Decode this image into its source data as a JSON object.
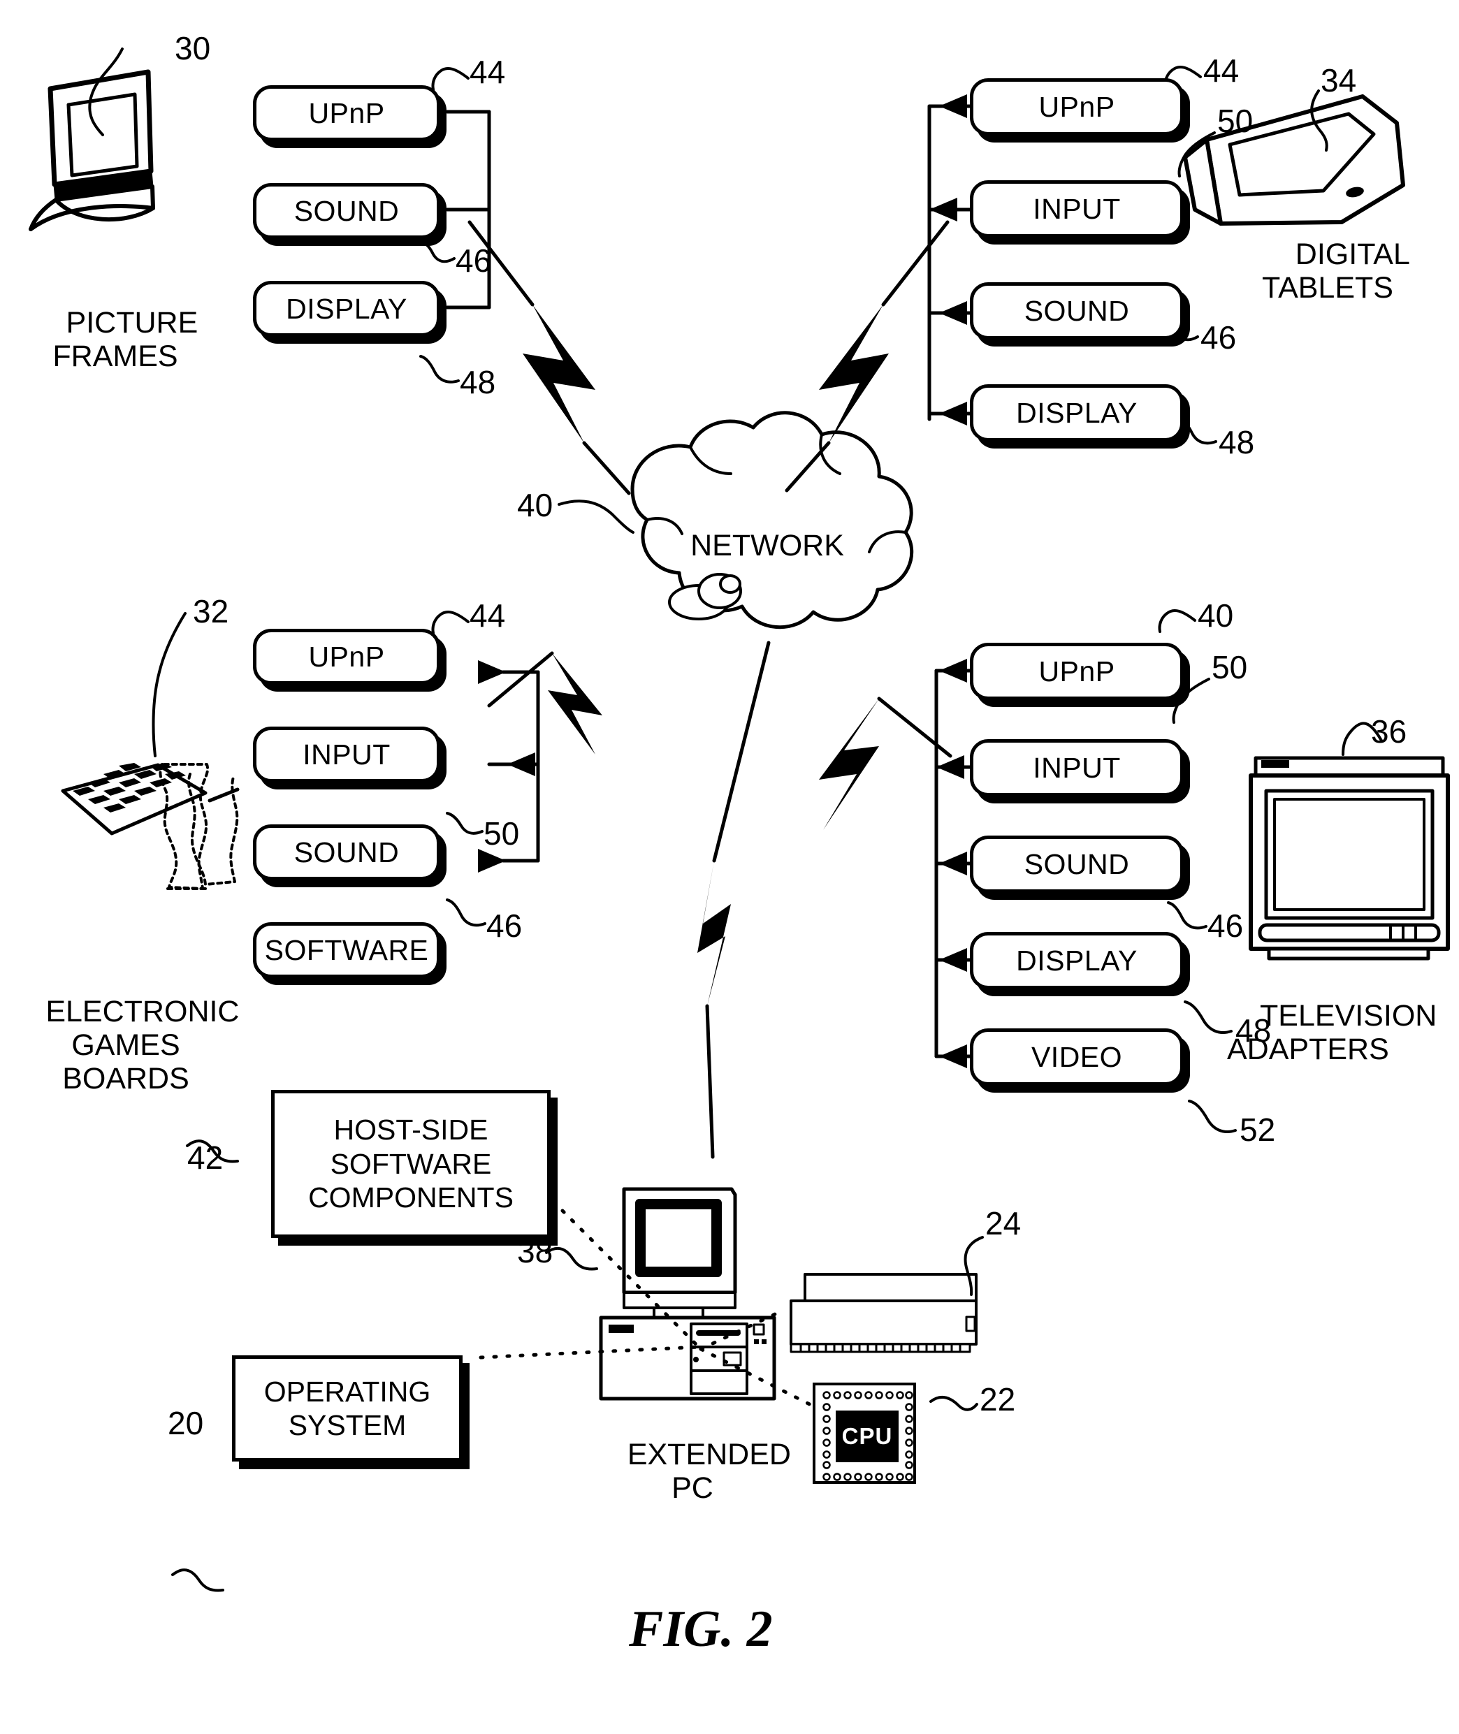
{
  "figure": {
    "caption": "FIG. 2",
    "network_label": "NETWORK"
  },
  "groups": [
    {
      "id": "picture-frames",
      "device_label": "PICTURE\nFRAMES",
      "device_ref": "30",
      "modules": [
        {
          "label": "UPnP",
          "ref": "44"
        },
        {
          "label": "SOUND",
          "ref": "46"
        },
        {
          "label": "DISPLAY",
          "ref": "48"
        }
      ]
    },
    {
      "id": "digital-tablets",
      "device_label": "DIGITAL\nTABLETS",
      "device_ref": "34",
      "modules": [
        {
          "label": "UPnP",
          "ref": "44"
        },
        {
          "label": "INPUT",
          "ref": "50"
        },
        {
          "label": "SOUND",
          "ref": "46"
        },
        {
          "label": "DISPLAY",
          "ref": "48"
        }
      ]
    },
    {
      "id": "electronic-games-boards",
      "device_label": "ELECTRONIC\nGAMES\nBOARDS",
      "device_ref": "32",
      "modules": [
        {
          "label": "UPnP",
          "ref": "44"
        },
        {
          "label": "INPUT",
          "ref": "50"
        },
        {
          "label": "SOUND",
          "ref": "46"
        },
        {
          "label": "SOFTWARE",
          "ref": ""
        }
      ]
    },
    {
      "id": "television-adapters",
      "device_label": "TELEVISION\nADAPTERS",
      "device_ref": "36",
      "modules": [
        {
          "label": "UPnP",
          "ref": "40"
        },
        {
          "label": "INPUT",
          "ref": "50"
        },
        {
          "label": "SOUND",
          "ref": "46"
        },
        {
          "label": "DISPLAY",
          "ref": "48"
        },
        {
          "label": "VIDEO",
          "ref": "52"
        }
      ]
    }
  ],
  "host": {
    "software_components_box": "HOST-SIDE\nSOFTWARE\nCOMPONENTS",
    "software_components_ref": "42",
    "operating_system_box": "OPERATING\nSYSTEM",
    "operating_system_ref": "20",
    "pc_label": "EXTENDED\nPC",
    "pc_ref": "38",
    "card_ref": "24",
    "cpu_label": "CPU",
    "cpu_ref": "22"
  },
  "network": {
    "label": "NETWORK",
    "ref": "40"
  },
  "colors": {
    "ink": "#000000",
    "paper": "#ffffff"
  }
}
